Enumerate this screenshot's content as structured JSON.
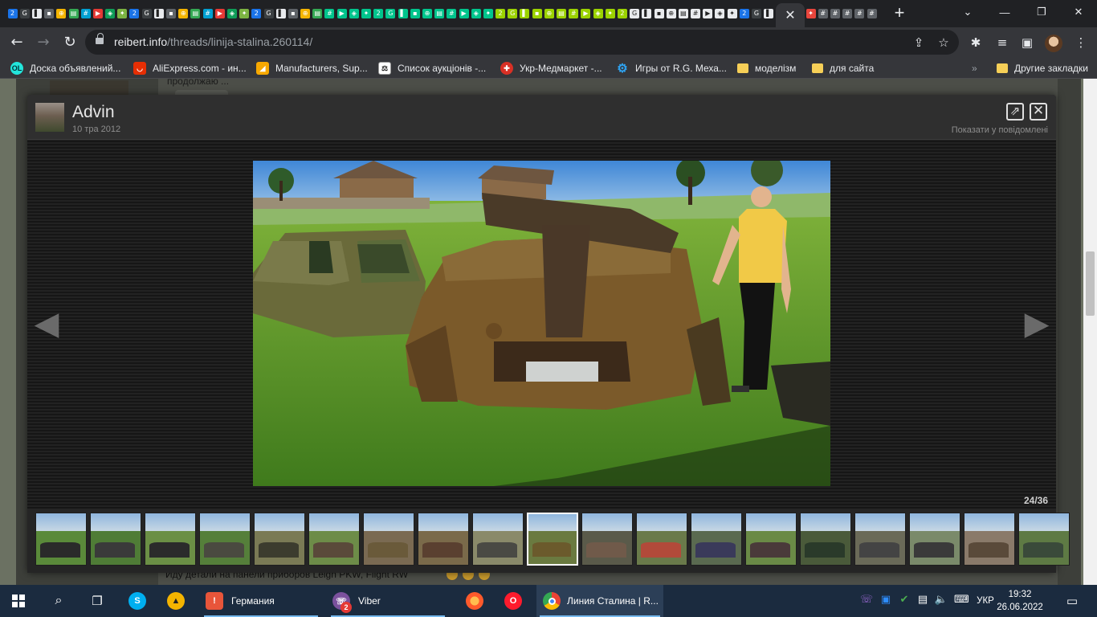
{
  "browser": {
    "pinned_tab_count": 63,
    "active_tab_close": "✕",
    "new_tab": "+",
    "url_host": "reibert.info",
    "url_path": "/threads/linija-stalina.260114/"
  },
  "bookmarks": [
    {
      "label": "Доска объявлений...",
      "icon": "olx-icon",
      "color": "#23e5db"
    },
    {
      "label": "AliExpress.com - ин...",
      "icon": "aliexpress-icon",
      "color": "#e62e04"
    },
    {
      "label": "Manufacturers, Sup...",
      "icon": "alibaba-icon",
      "color": "#f7a800"
    },
    {
      "label": "Список аукціонів -...",
      "icon": "auction-icon",
      "color": "#ffffff"
    },
    {
      "label": "Укр-Медмаркет -...",
      "icon": "medmarket-icon",
      "color": "#d93025"
    },
    {
      "label": "Игры от R.G. Меха...",
      "icon": "gear-icon",
      "color": "#2ea3f2"
    },
    {
      "label": "моделізм",
      "icon": "folder-icon",
      "color": "#f6cf57"
    },
    {
      "label": "для сайта",
      "icon": "folder-icon",
      "color": "#f6cf57"
    }
  ],
  "bookmarks_overflow": "»",
  "other_bookmarks": "Другие закладки",
  "page_behind": {
    "snippet_top": "продолжаю ...",
    "snippet_bottom": "Иду детали на панели приборов Leign PKW, Flight RW"
  },
  "lightbox": {
    "author": "Advin",
    "date": "10 тра 2012",
    "show_in_post": "Показати у повідомлені",
    "counter": "24/36",
    "prev_arrow": "◀",
    "next_arrow": "▶",
    "thumbnail_count": 19,
    "selected_thumbnail": 10
  },
  "taskbar": {
    "items": [
      {
        "label": "Германия",
        "icon": "pdf-reader-icon",
        "color": "#e8553a"
      },
      {
        "label": "Viber",
        "icon": "viber-icon",
        "color": "#7b519d",
        "badge": "2"
      },
      {
        "label": "Линия Сталина | R...",
        "icon": "chrome-icon",
        "color": "#4caf50"
      }
    ],
    "language": "УКР",
    "time": "19:32",
    "date": "26.06.2022"
  }
}
